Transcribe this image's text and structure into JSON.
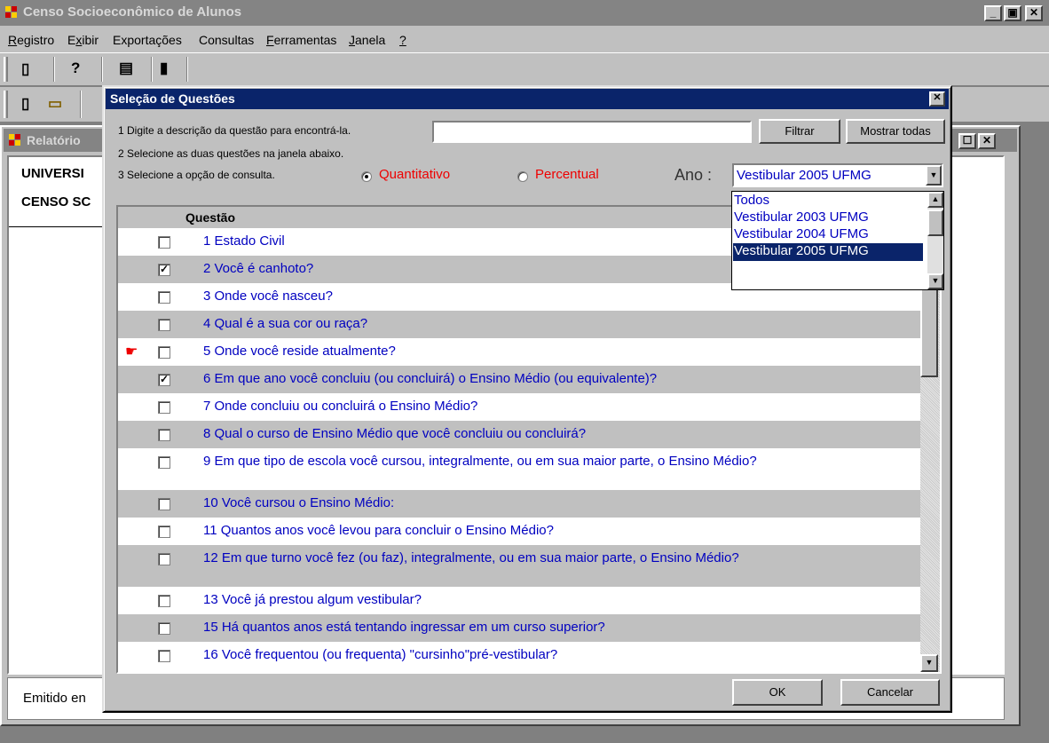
{
  "app": {
    "title": "Censo Socioeconômico de Alunos"
  },
  "window_buttons": {
    "minimize": "_",
    "maximize": "▣",
    "close": "✕"
  },
  "menu": [
    "Registro",
    "Exibir",
    "Exportações",
    "Consultas",
    "Ferramentas",
    "Janela",
    "?"
  ],
  "menu_underline_index": [
    0,
    1,
    -1,
    -1,
    0,
    0,
    0
  ],
  "toolbar_icons": [
    "new-document-icon",
    "help-icon",
    "print-icon",
    "exit-door-icon",
    "new-document-icon",
    "open-folder-icon"
  ],
  "report": {
    "title": "Relatório",
    "line1": "UNIVERSI",
    "line2": "CENSO SC",
    "footer": "Emitido en"
  },
  "dialog": {
    "title": "Seleção de Questões",
    "step1": "1  Digite a descrição da questão para encontrá-la.",
    "step2": "2 Selecione as duas questões na janela abaixo.",
    "step3": "3 Selecione a opção de consulta.",
    "filter_value": "",
    "filter_button": "Filtrar",
    "show_all_button": "Mostrar todas",
    "radio_quantitativo": "Quantitativo",
    "radio_percentual": "Percentual",
    "selected_mode": "Quantitativo",
    "ano_label": "Ano :",
    "ano_value": "Vestibular 2005 UFMG",
    "ano_options": [
      "Todos",
      "Vestibular 2003 UFMG",
      "Vestibular 2004 UFMG",
      "Vestibular 2005 UFMG"
    ],
    "ano_selected_index": 3,
    "grid_header": "Questão",
    "ok_button": "OK",
    "cancel_button": "Cancelar"
  },
  "questions": [
    {
      "text": "1 Estado Civil",
      "checked": false
    },
    {
      "text": "2 Você é canhoto?",
      "checked": true
    },
    {
      "text": "3 Onde você nasceu?",
      "checked": false
    },
    {
      "text": "4 Qual é a sua cor ou raça?",
      "checked": false
    },
    {
      "text": "5 Onde você reside atualmente?",
      "checked": false,
      "pointer": true
    },
    {
      "text": "6 Em que ano você concluiu (ou concluirá) o Ensino Médio (ou equivalente)?",
      "checked": true
    },
    {
      "text": "7 Onde concluiu ou concluirá o Ensino Médio?",
      "checked": false
    },
    {
      "text": "8 Qual o curso de Ensino Médio que você concluiu ou concluirá?",
      "checked": false
    },
    {
      "text": "9 Em que tipo de escola você cursou, integralmente, ou em sua maior parte, o Ensino Médio?",
      "checked": false
    },
    {
      "text": "10 Você cursou o Ensino Médio:",
      "checked": false
    },
    {
      "text": "11 Quantos anos você levou para concluir o Ensino Médio?",
      "checked": false
    },
    {
      "text": "12 Em que turno você fez (ou faz), integralmente, ou em sua maior parte, o Ensino Médio?",
      "checked": false
    },
    {
      "text": "13 Você já prestou algum vestibular?",
      "checked": false
    },
    {
      "text": "15 Há quantos anos está tentando ingressar em um curso superior?",
      "checked": false
    },
    {
      "text": "16 Você frequentou (ou frequenta) \"cursinho\"pré-vestibular?",
      "checked": false
    }
  ]
}
